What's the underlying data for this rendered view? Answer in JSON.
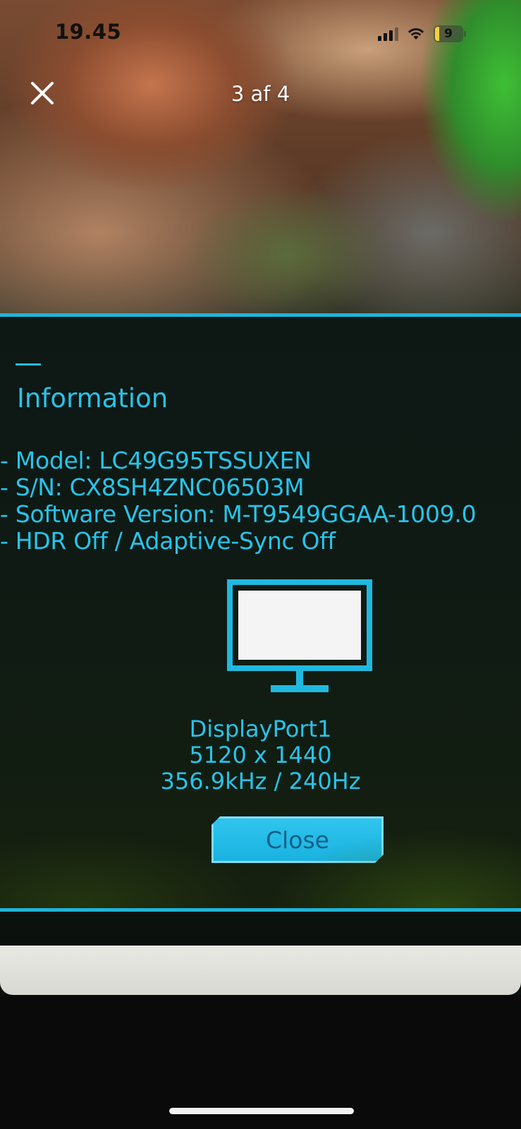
{
  "status_bar": {
    "time": "19.45",
    "battery_level": "9",
    "battery_color": "#f4d13b"
  },
  "viewer": {
    "counter": "3 af 4",
    "close_icon": "close-icon"
  },
  "osd": {
    "accent_color": "#27c4ea",
    "title": "Information",
    "info_lines": [
      "- Model: LC49G95TSSUXEN",
      "- S/N: CX8SH4ZNC06503M",
      "- Software Version: M-T9549GGAA-1009.0",
      "- HDR  Off / Adaptive-Sync Off"
    ],
    "monitor_icon": "monitor-icon",
    "input_port": "DisplayPort1",
    "resolution": "5120 x 1440",
    "frequency": "356.9kHz / 240Hz",
    "close_label": "Close"
  }
}
